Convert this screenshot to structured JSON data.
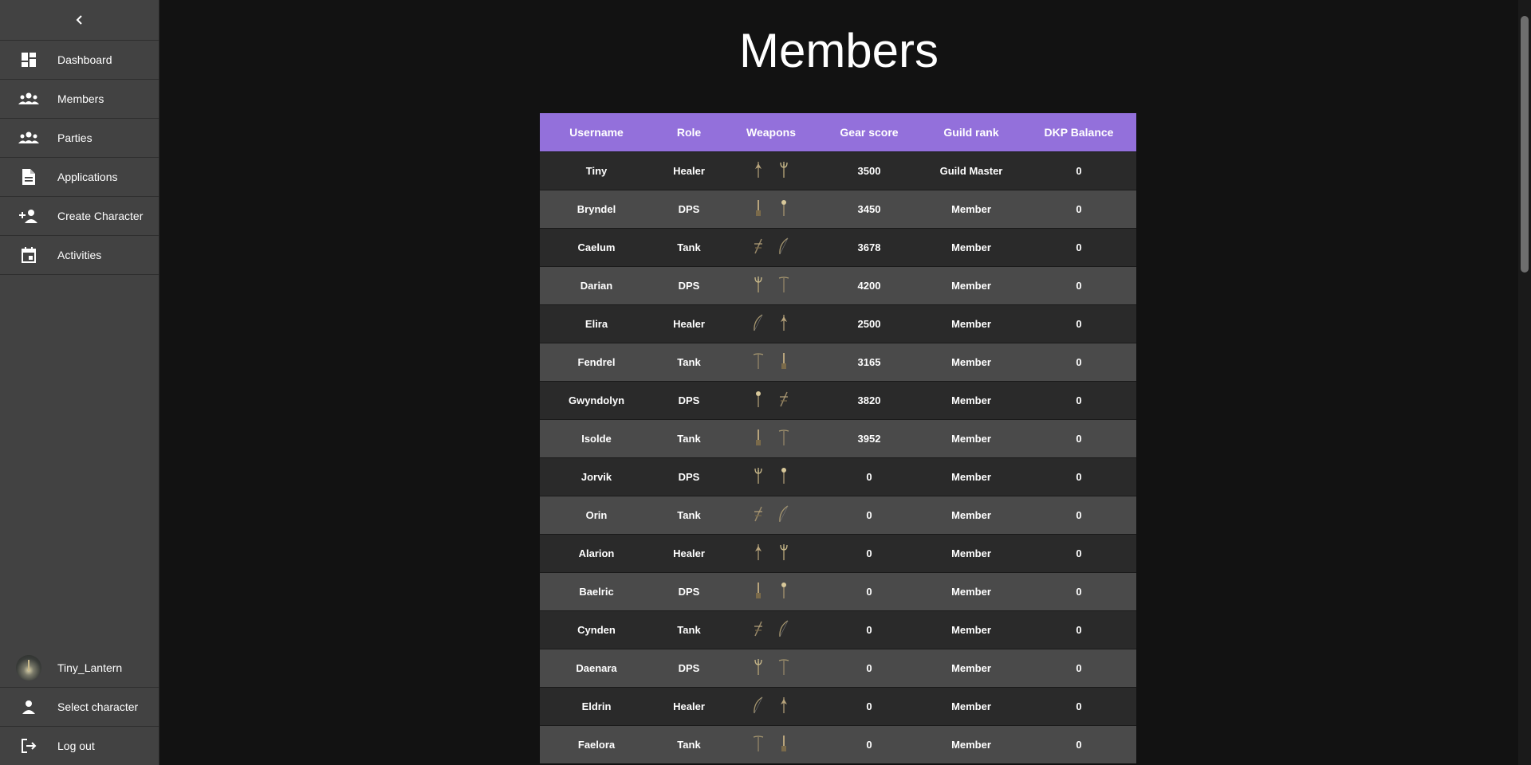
{
  "sidebar": {
    "items": [
      {
        "label": "Dashboard",
        "icon": "dashboard-icon"
      },
      {
        "label": "Members",
        "icon": "group-icon"
      },
      {
        "label": "Parties",
        "icon": "group-icon"
      },
      {
        "label": "Applications",
        "icon": "document-icon"
      },
      {
        "label": "Create Character",
        "icon": "person-add-icon"
      },
      {
        "label": "Activities",
        "icon": "calendar-icon"
      }
    ],
    "user": {
      "name": "Tiny_Lantern"
    },
    "select_character": "Select character",
    "log_out": "Log out"
  },
  "page": {
    "title": "Members"
  },
  "table": {
    "headers": [
      "Username",
      "Role",
      "Weapons",
      "Gear score",
      "Guild rank",
      "DKP Balance"
    ],
    "rows": [
      {
        "username": "Tiny",
        "role": "Healer",
        "weapons": [
          "staff",
          "wand"
        ],
        "gear_score": "3500",
        "guild_rank": "Guild Master",
        "dkp": "0"
      },
      {
        "username": "Bryndel",
        "role": "DPS",
        "weapons": [
          "dagger",
          "mace"
        ],
        "gear_score": "3450",
        "guild_rank": "Member",
        "dkp": "0"
      },
      {
        "username": "Caelum",
        "role": "Tank",
        "weapons": [
          "crossbow",
          "bow"
        ],
        "gear_score": "3678",
        "guild_rank": "Member",
        "dkp": "0"
      },
      {
        "username": "Darian",
        "role": "DPS",
        "weapons": [
          "wand",
          "spear"
        ],
        "gear_score": "4200",
        "guild_rank": "Member",
        "dkp": "0"
      },
      {
        "username": "Elira",
        "role": "Healer",
        "weapons": [
          "bow",
          "staff"
        ],
        "gear_score": "2500",
        "guild_rank": "Member",
        "dkp": "0"
      },
      {
        "username": "Fendrel",
        "role": "Tank",
        "weapons": [
          "spear",
          "dagger"
        ],
        "gear_score": "3165",
        "guild_rank": "Member",
        "dkp": "0"
      },
      {
        "username": "Gwyndolyn",
        "role": "DPS",
        "weapons": [
          "mace",
          "crossbow"
        ],
        "gear_score": "3820",
        "guild_rank": "Member",
        "dkp": "0"
      },
      {
        "username": "Isolde",
        "role": "Tank",
        "weapons": [
          "dagger",
          "spear"
        ],
        "gear_score": "3952",
        "guild_rank": "Member",
        "dkp": "0"
      },
      {
        "username": "Jorvik",
        "role": "DPS",
        "weapons": [
          "wand",
          "mace"
        ],
        "gear_score": "0",
        "guild_rank": "Member",
        "dkp": "0"
      },
      {
        "username": "Orin",
        "role": "Tank",
        "weapons": [
          "crossbow",
          "bow"
        ],
        "gear_score": "0",
        "guild_rank": "Member",
        "dkp": "0"
      },
      {
        "username": "Alarion",
        "role": "Healer",
        "weapons": [
          "staff",
          "wand"
        ],
        "gear_score": "0",
        "guild_rank": "Member",
        "dkp": "0"
      },
      {
        "username": "Baelric",
        "role": "DPS",
        "weapons": [
          "dagger",
          "mace"
        ],
        "gear_score": "0",
        "guild_rank": "Member",
        "dkp": "0"
      },
      {
        "username": "Cynden",
        "role": "Tank",
        "weapons": [
          "crossbow",
          "bow"
        ],
        "gear_score": "0",
        "guild_rank": "Member",
        "dkp": "0"
      },
      {
        "username": "Daenara",
        "role": "DPS",
        "weapons": [
          "wand",
          "spear"
        ],
        "gear_score": "0",
        "guild_rank": "Member",
        "dkp": "0"
      },
      {
        "username": "Eldrin",
        "role": "Healer",
        "weapons": [
          "bow",
          "staff"
        ],
        "gear_score": "0",
        "guild_rank": "Member",
        "dkp": "0"
      },
      {
        "username": "Faelora",
        "role": "Tank",
        "weapons": [
          "spear",
          "dagger"
        ],
        "gear_score": "0",
        "guild_rank": "Member",
        "dkp": "0"
      }
    ]
  },
  "colors": {
    "header_accent": "#9370db",
    "sidebar_bg": "#424242",
    "page_bg": "#121212"
  }
}
